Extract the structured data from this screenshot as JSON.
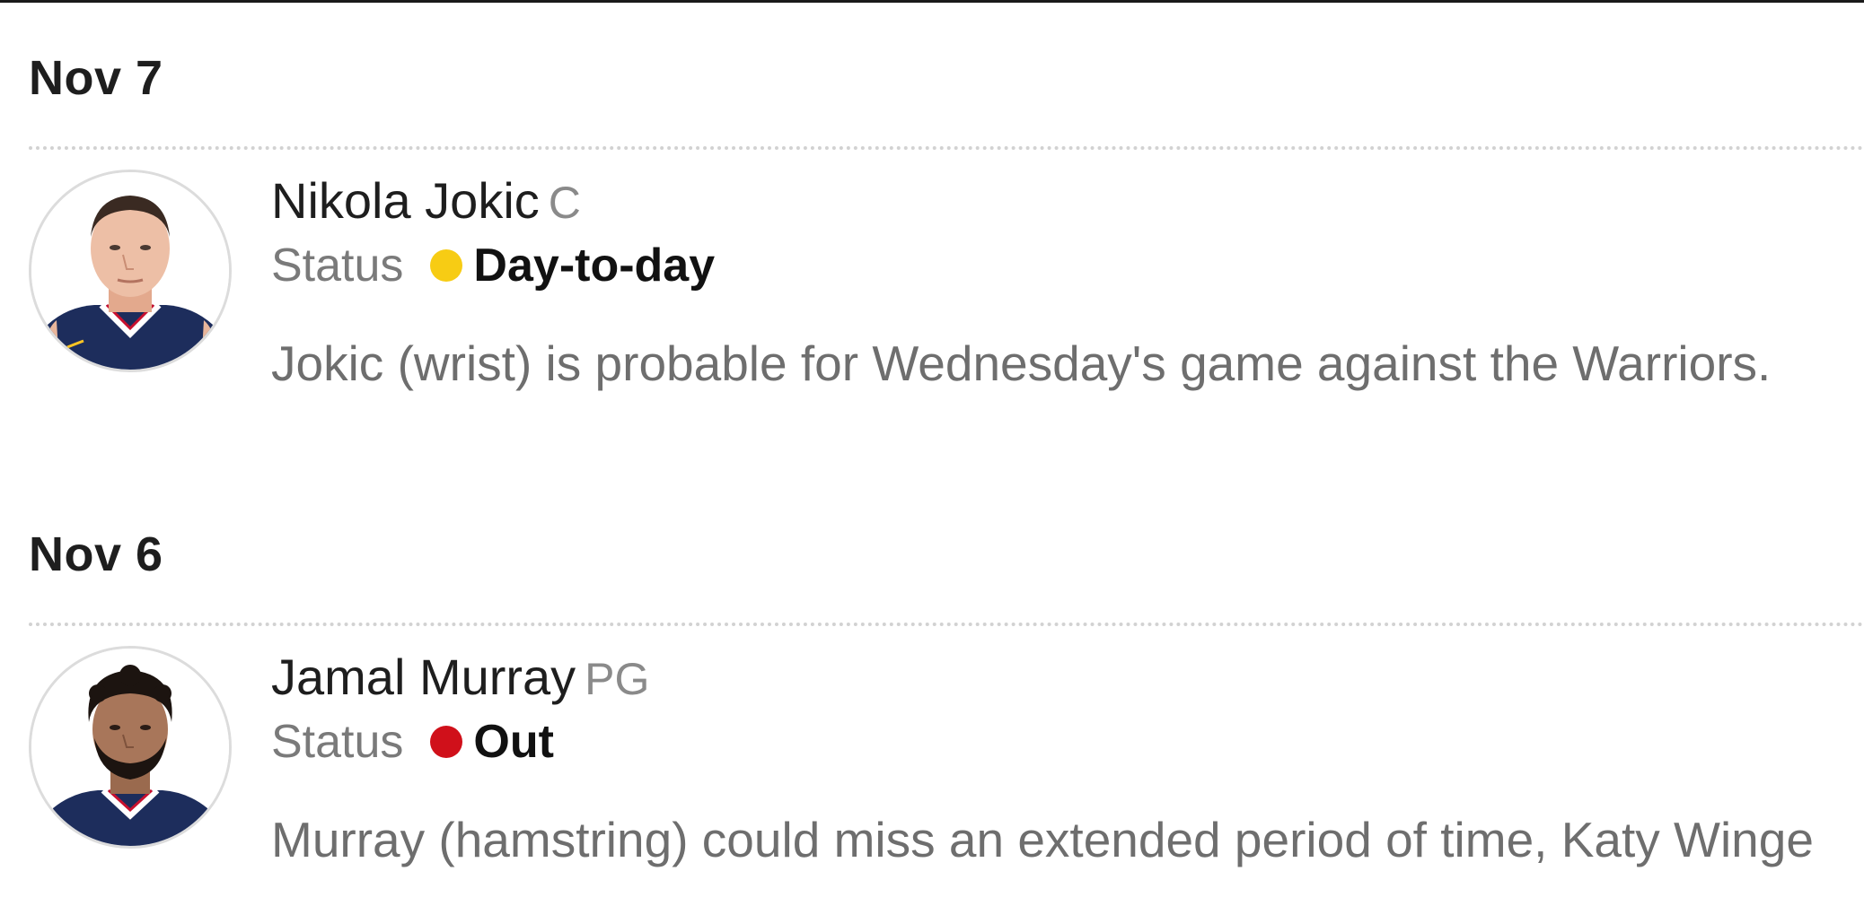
{
  "entries": [
    {
      "date": "Nov 7",
      "player": {
        "name": "Nikola Jokic",
        "position": "C",
        "avatar": "player-headshot-jokic"
      },
      "status_label": "Status",
      "status": "Day-to-day",
      "status_color": "#f7cc14",
      "news": "Jokic (wrist) is probable for Wednesday's game against the Warriors."
    },
    {
      "date": "Nov 6",
      "player": {
        "name": "Jamal Murray",
        "position": "PG",
        "avatar": "player-headshot-murray"
      },
      "status_label": "Status",
      "status": "Out",
      "status_color": "#d0101a",
      "news": "Murray (hamstring) could miss an extended period of time, Katy Winge"
    }
  ]
}
